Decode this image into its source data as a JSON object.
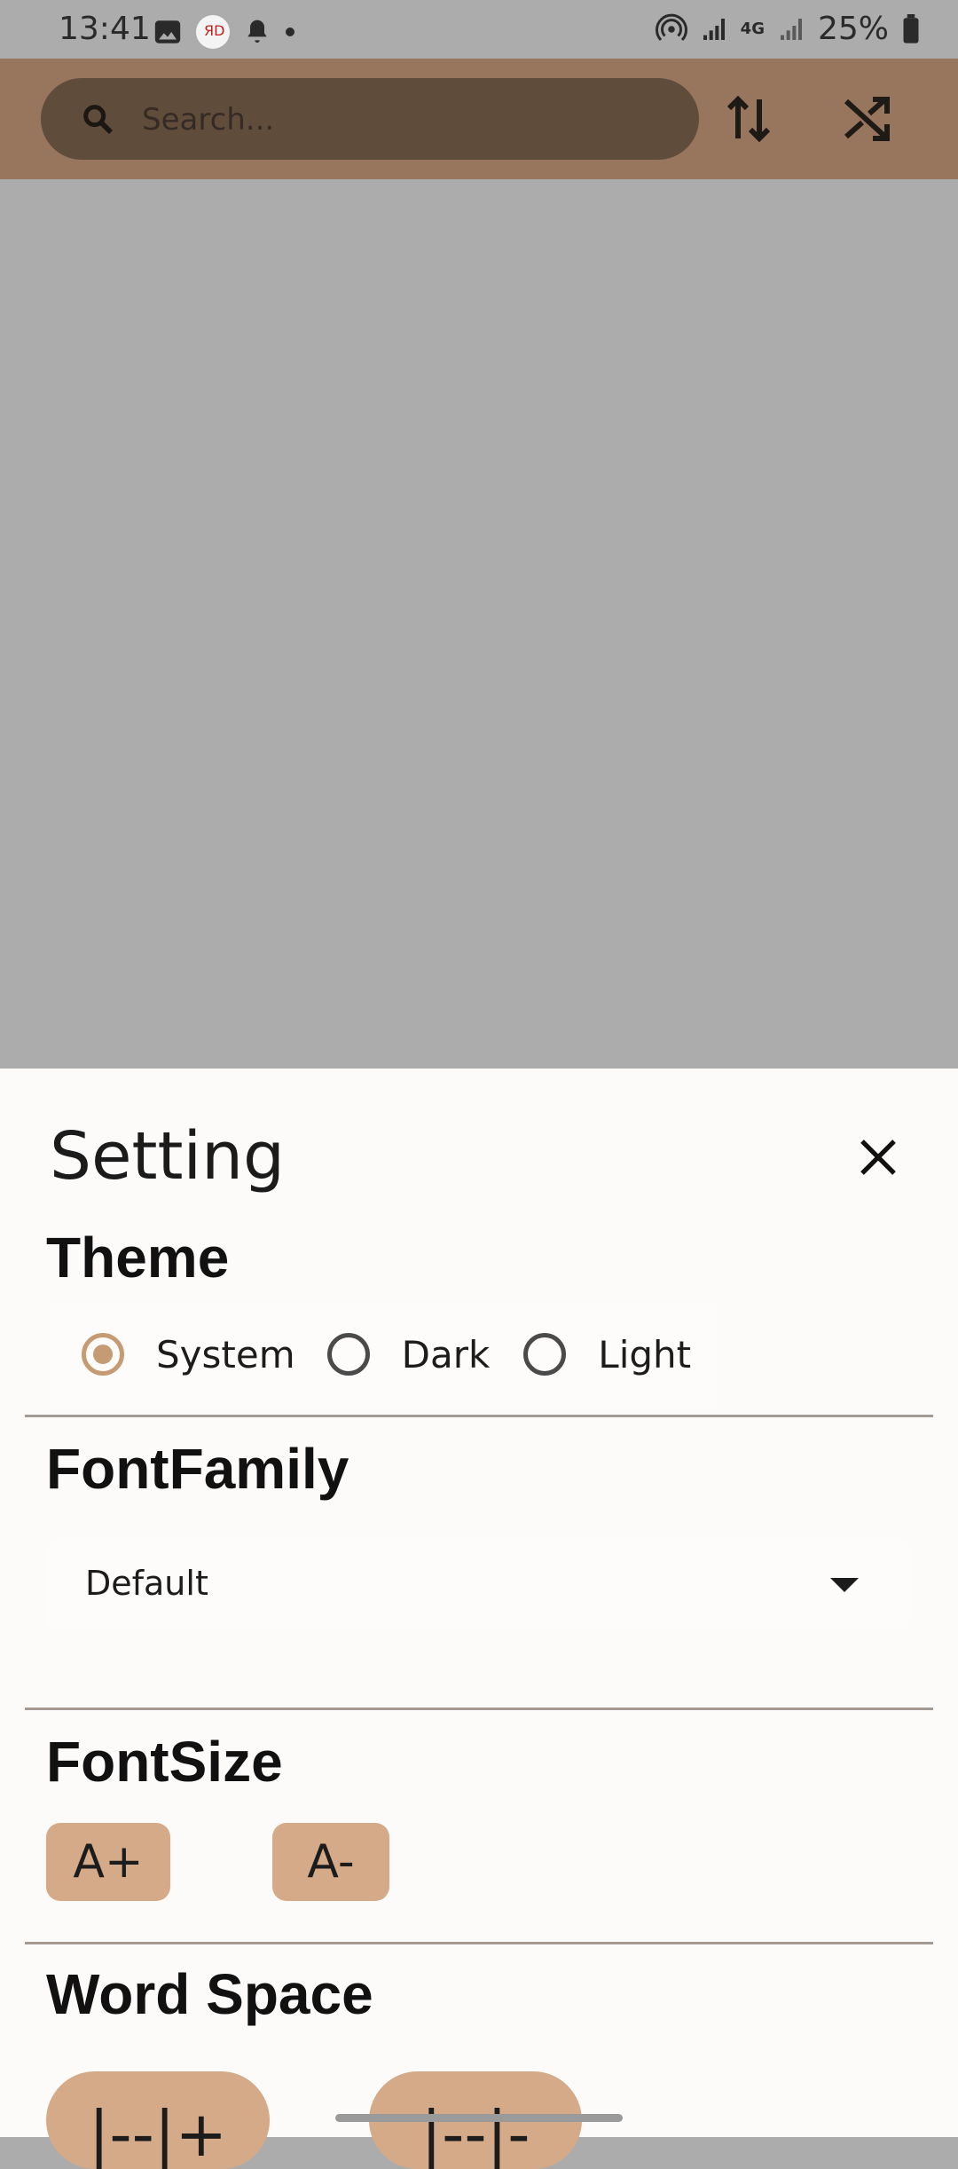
{
  "status_bar": {
    "time": "13:41",
    "battery": "25%",
    "network": "4G"
  },
  "app_bar": {
    "search_placeholder": "Search..."
  },
  "sheet": {
    "title": "Setting",
    "theme": {
      "title": "Theme",
      "options": [
        {
          "label": "System",
          "selected": true
        },
        {
          "label": "Dark",
          "selected": false
        },
        {
          "label": "Light",
          "selected": false
        }
      ]
    },
    "font_family": {
      "title": "FontFamily",
      "selected": "Default"
    },
    "font_size": {
      "title": "FontSize",
      "increase_label": "A+",
      "decrease_label": "A-"
    },
    "word_space": {
      "title": "Word Space",
      "increase_label": "|--|+",
      "decrease_label": "|--|-"
    }
  },
  "colors": {
    "app_bar": "#98765e",
    "accent": "#c49b72",
    "button": "#d4aa88",
    "scrim": "#acacac"
  }
}
